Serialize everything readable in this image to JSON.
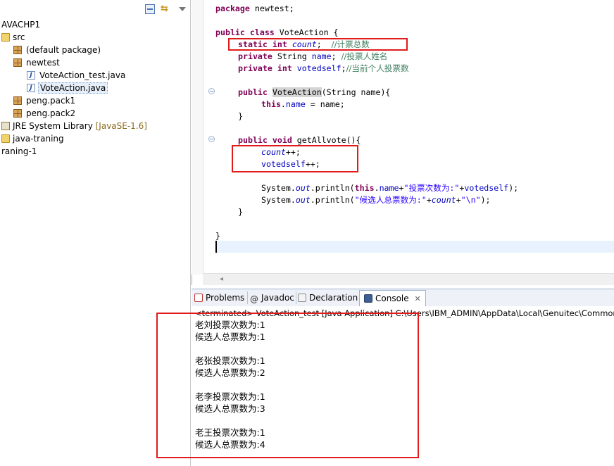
{
  "explorer": {
    "items": [
      {
        "label": "AVACHP1",
        "icon": "project-icon"
      },
      {
        "label": "src",
        "icon": "source-folder-icon"
      },
      {
        "label": "(default package)",
        "icon": "package-icon"
      },
      {
        "label": "newtest",
        "icon": "package-icon"
      },
      {
        "label": "VoteAction_test.java",
        "icon": "java-file-icon"
      },
      {
        "label": "VoteAction.java",
        "icon": "java-file-icon",
        "selected": true
      },
      {
        "label": "peng.pack1",
        "icon": "package-icon"
      },
      {
        "label": "peng.pack2",
        "icon": "package-icon"
      },
      {
        "label": "JRE System Library",
        "tag": "[JavaSE-1.6]",
        "icon": "library-icon"
      },
      {
        "label": "java-traning",
        "icon": "folder-icon"
      },
      {
        "label": "raning-1",
        "icon": ""
      }
    ]
  },
  "editor": {
    "lines": {
      "l1_kw": "package",
      "l1_rest": " newtest;",
      "l2_kw1": "public",
      "l2_kw2": "class",
      "l2_rest": " VoteAction {",
      "l3_kw1": "static",
      "l3_kw2": "int",
      "l3_var": "count",
      "l3_semi": ";  ",
      "l3_cm": "//计票总数",
      "l4_kw": "private",
      "l4_mid": " String ",
      "l4_var": "name",
      "l4_semi": "; ",
      "l4_cm": "//投票人姓名",
      "l5_kw1": "private",
      "l5_kw2": "int",
      "l5_var": "votedself",
      "l5_semi": ";",
      "l5_cm": "//当前个人投票数",
      "l6_kw": "public",
      "l6_ctor": "VoteAction",
      "l6_rest": "(String name){",
      "l7_kw": "this",
      "l7_dot": ".",
      "l7_fld": "name",
      "l7_rest": " = name;",
      "l8": "}",
      "l9_kw1": "public",
      "l9_kw2": "void",
      "l9_rest": " getAllvote(){",
      "l10_var": "count",
      "l10_rest": "++;",
      "l11_var": "votedself",
      "l11_rest": "++;",
      "l12_a": "System.",
      "l12_out": "out",
      "l12_b": ".println(",
      "l12_kw": "this",
      "l12_dot": ".",
      "l12_fld": "name",
      "l12_plus": "+",
      "l12_str": "\"投票次数为:\"",
      "l12_c": "+",
      "l12_fld2": "votedself",
      "l12_end": ");",
      "l13_a": "System.",
      "l13_out": "out",
      "l13_b": ".println(",
      "l13_str": "\"候选人总票数为:\"",
      "l13_plus": "+",
      "l13_var": "count",
      "l13_plus2": "+",
      "l13_str2": "\"\\n\"",
      "l13_end": ");",
      "l14": "}",
      "l15": "}"
    }
  },
  "views": {
    "tabs": [
      {
        "label": "Problems",
        "icon": "problems-icon"
      },
      {
        "label": "Javadoc",
        "icon": "javadoc-icon"
      },
      {
        "label": "Declaration",
        "icon": "declaration-icon"
      },
      {
        "label": "Console",
        "icon": "console-icon",
        "active": true
      }
    ],
    "close_glyph": "✕"
  },
  "console": {
    "terminated": "<terminated> VoteAction_test [Java Application] C:\\Users\\IBM_ADMIN\\AppData\\Local\\Genuitec\\Common\\binary",
    "output": [
      "老刘投票次数为:1",
      "候选人总票数为:1",
      "",
      "老张投票次数为:1",
      "候选人总票数为:2",
      "",
      "老李投票次数为:1",
      "候选人总票数为:3",
      "",
      "老王投票次数为:1",
      "候选人总票数为:4"
    ]
  },
  "colors": {
    "keyword": "#7f0055",
    "field": "#0000c0",
    "comment": "#3f7f5f",
    "string": "#2a00ff",
    "annotation": "#e01b1b"
  }
}
